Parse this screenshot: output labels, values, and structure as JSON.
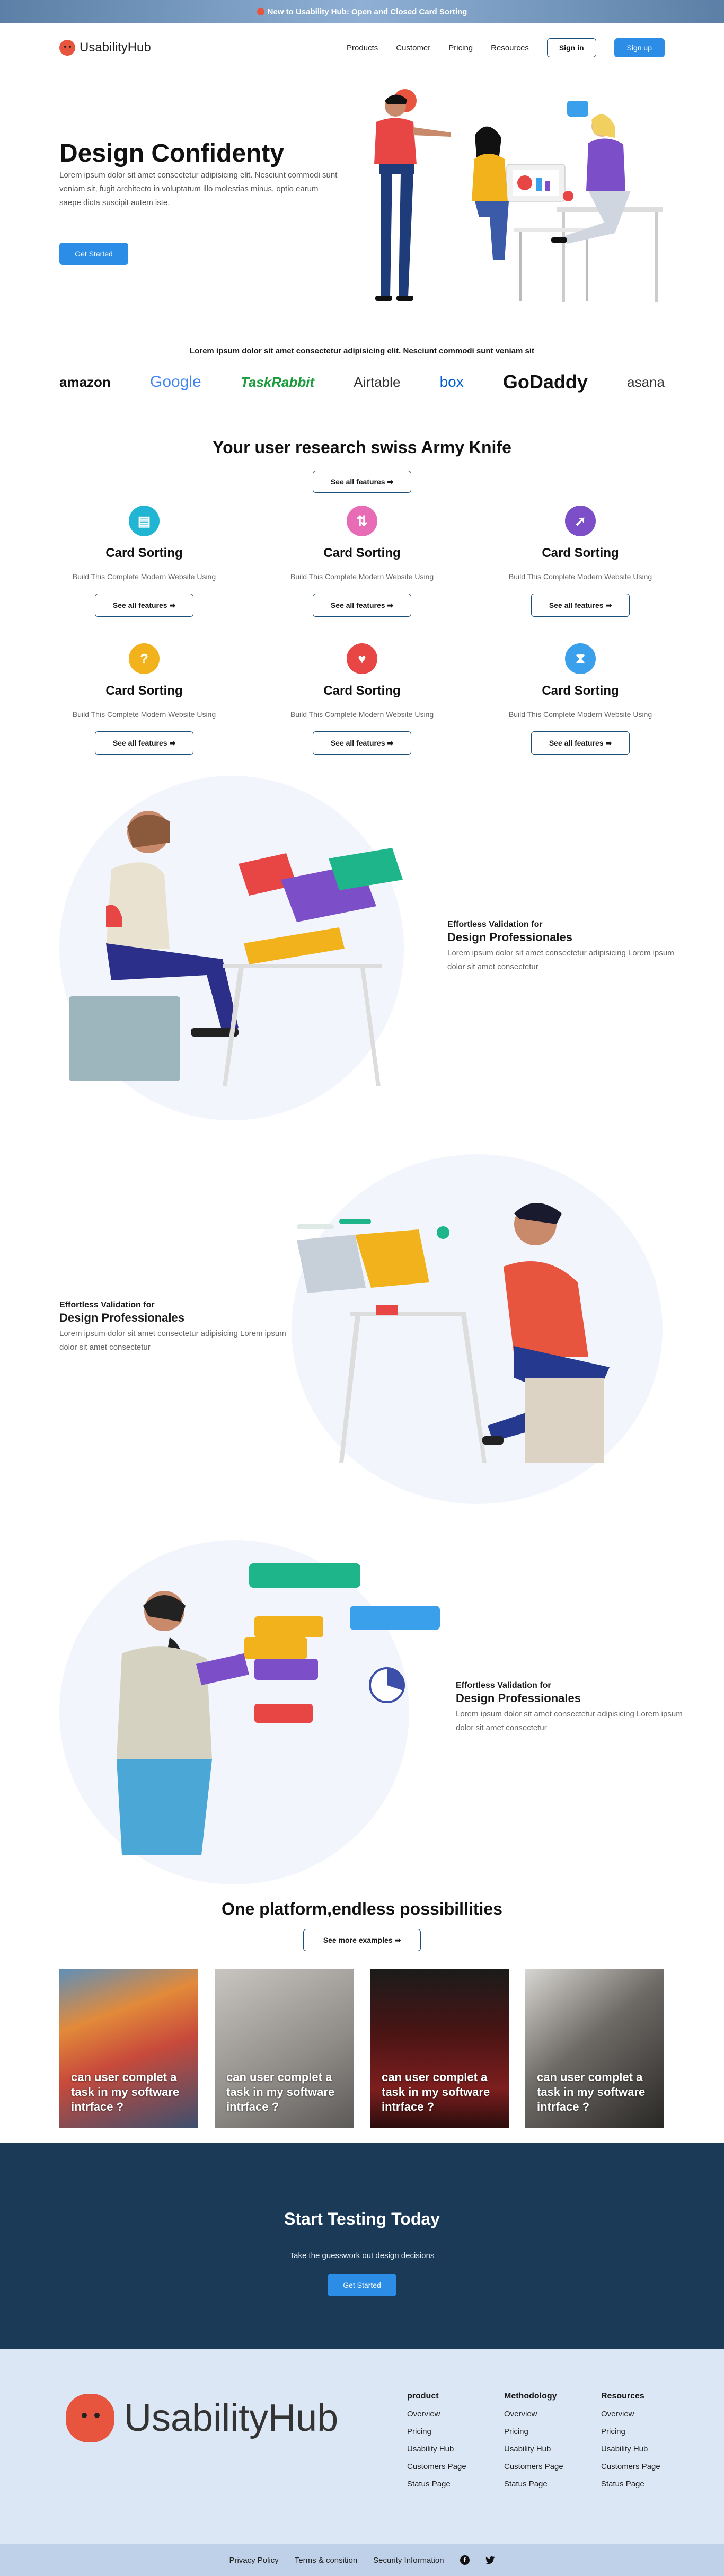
{
  "announcement": {
    "text": "New to Usability Hub: Open and Closed Card Sorting"
  },
  "nav": {
    "brand": "UsabilityHub",
    "links": [
      "Products",
      "Customer",
      "Pricing",
      "Resources"
    ],
    "sign_in": "Sign in",
    "sign_up": "Sign up"
  },
  "hero": {
    "title": "Design Confidenty",
    "text": "Lorem ipsum dolor sit amet consectetur adipisicing elit. Nesciunt commodi sunt veniam sit, fugit architecto in voluptatum illo molestias minus, optio earum saepe dicta suscipit autem iste.",
    "cta": "Get Started"
  },
  "trust": {
    "text": "Lorem ipsum dolor sit amet consectetur adipisicing elit. Nesciunt commodi sunt veniam sit",
    "logos": [
      "amazon",
      "Google",
      "TaskRabbit",
      "Airtable",
      "box",
      "GoDaddy",
      "asana"
    ]
  },
  "features": {
    "title": "Your user research swiss Army Knife",
    "button": "See all features ➡",
    "items": [
      {
        "icon": "card-icon",
        "title": "Card Sorting",
        "text": "Build This Complete Modern Website Using",
        "button": "See all features ➡"
      },
      {
        "icon": "sort-arrows-icon",
        "title": "Card Sorting",
        "text": "Build This Complete Modern Website Using",
        "button": "See all features ➡"
      },
      {
        "icon": "cursor-icon",
        "title": "Card Sorting",
        "text": "Build This Complete Modern Website Using",
        "button": "See all features ➡"
      },
      {
        "icon": "question-icon",
        "title": "Card Sorting",
        "text": "Build This Complete Modern Website Using",
        "button": "See all features ➡"
      },
      {
        "icon": "heart-icon",
        "title": "Card Sorting",
        "text": "Build This Complete Modern Website Using",
        "button": "See all features ➡"
      },
      {
        "icon": "hourglass-icon",
        "title": "Card Sorting",
        "text": "Build This Complete Modern Website Using",
        "button": "See all features ➡"
      }
    ],
    "colors": [
      "#1fb5d3",
      "#e86bb6",
      "#7c4fc9",
      "#f2b21b",
      "#e84545",
      "#3aa0ec"
    ]
  },
  "validation": [
    {
      "kicker": "Effortless Validation for",
      "title": "Design Professionales",
      "text": "Lorem ipsum dolor sit amet consectetur adipisicing Lorem ipsum dolor sit amet consectetur"
    },
    {
      "kicker": "Effortless Validation for",
      "title": "Design Professionales",
      "text": "Lorem ipsum dolor sit amet consectetur adipisicing Lorem ipsum dolor sit amet consectetur"
    },
    {
      "kicker": "Effortless Validation for",
      "title": "Design Professionales",
      "text": "Lorem ipsum dolor sit amet consectetur adipisicing Lorem ipsum dolor sit amet consectetur"
    }
  ],
  "platform": {
    "title": "One platform,endless possibillities",
    "button": "See more examples ➡",
    "cards": [
      {
        "caption": "can user complet a task in my software intrface ?"
      },
      {
        "caption": "can user complet a task in my software intrface ?"
      },
      {
        "caption": "can user complet a task in my software intrface ?"
      },
      {
        "caption": "can user complet a task in my software intrface ?"
      }
    ]
  },
  "cta": {
    "title": "Start Testing Today",
    "text": "Take the guesswork out design decisions",
    "button": "Get Started"
  },
  "footer": {
    "brand": "UsabilityHub",
    "columns": [
      {
        "heading": "product",
        "links": [
          "Overview",
          "Pricing",
          "Usability Hub",
          "Customers Page",
          "Status Page"
        ]
      },
      {
        "heading": "Methodology",
        "links": [
          "Overview",
          "Pricing",
          "Usability Hub",
          "Customers Page",
          "Status Page"
        ]
      },
      {
        "heading": "Resources",
        "links": [
          "Overview",
          "Pricing",
          "Usability Hub",
          "Customers Page",
          "Status Page"
        ]
      }
    ],
    "bottom_links": [
      "Privacy Policy",
      "Terms & consition",
      "Security Information"
    ]
  }
}
